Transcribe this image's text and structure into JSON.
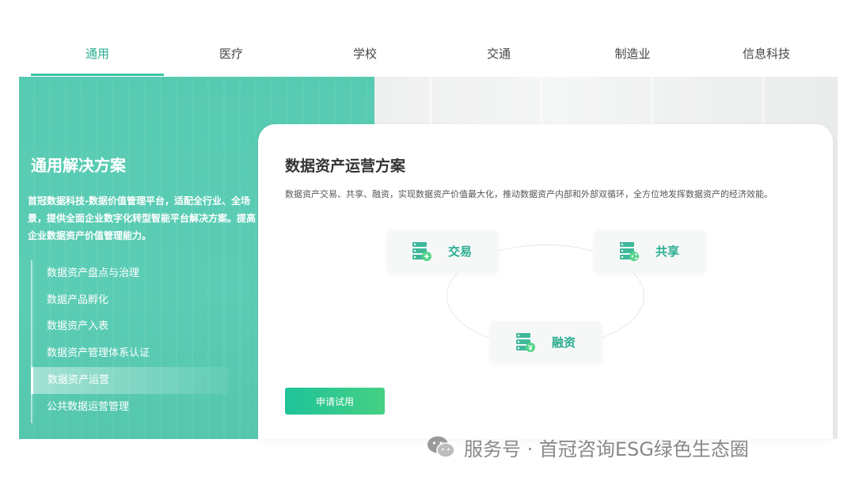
{
  "tabs": [
    {
      "label": "通用",
      "active": true
    },
    {
      "label": "医疗"
    },
    {
      "label": "学校"
    },
    {
      "label": "交通"
    },
    {
      "label": "制造业"
    },
    {
      "label": "信息科技"
    }
  ],
  "left_panel": {
    "title": "通用解决方案",
    "description": "首冠数据科技-数据价值管理平台，适配全行业、全场景，提供全面企业数字化转型智能平台解决方案。提高企业数据资产价值管理能力。",
    "menu": [
      {
        "label": "数据资产盘点与治理"
      },
      {
        "label": "数据产品孵化"
      },
      {
        "label": "数据资产入表"
      },
      {
        "label": "数据资产管理体系认证"
      },
      {
        "label": "数据资产运营",
        "active": true
      },
      {
        "label": "公共数据运营管理"
      }
    ]
  },
  "card": {
    "title": "数据资产运营方案",
    "description": "数据资产交易、共享、融资，实现数据资产价值最大化，推动数据资产内部和外部双循环，全方位地发挥数据资产的经济效能。",
    "nodes": [
      {
        "label": "交易",
        "icon": "server-stack-icon"
      },
      {
        "label": "共享",
        "icon": "server-stack-icon"
      },
      {
        "label": "融资",
        "icon": "server-stack-icon"
      }
    ],
    "button_label": "申请试用"
  },
  "watermark": {
    "text": "服务号 · 首冠咨询ESG绿色生态圈",
    "icon": "wechat-icon"
  },
  "colors": {
    "accent": "#2aae8f",
    "panel": "#57cbb2",
    "button_start": "#1fc39a",
    "button_end": "#45d083"
  }
}
